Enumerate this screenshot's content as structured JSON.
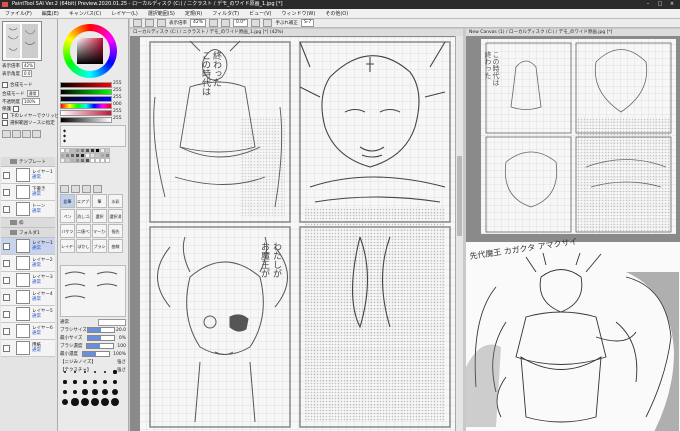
{
  "window": {
    "title": "PaintTool SAI Ver.2 (64bit) Preview.2020.01.25 - ローカルディスク (C:) / ニクラスト / デモ_のワイド原画_1.jpg [*]",
    "controls": [
      "–",
      "□",
      "×"
    ]
  },
  "menu": [
    "ファイル(F)",
    "編集(E)",
    "キャンバス(C)",
    "レイヤー(L)",
    "選択範囲(S)",
    "定規(R)",
    "フィルタ(T)",
    "ビュー(V)",
    "ウィンドウ(W)",
    "その他(O)"
  ],
  "toolbar": {
    "zoom_label": "表示倍率",
    "zoom_value": "42%",
    "angle_value": "0.0°",
    "stabilizer_label": "手ぶれ補正"
  },
  "navigator": {
    "zoom_label": "表示倍率",
    "zoom_value": "42%",
    "angle_label": "表示角度",
    "angle_value": "0.0"
  },
  "layer_panel": {
    "header": "合成モード",
    "blend_label": "合成モード",
    "blend_value": "通常",
    "opacity_label": "不透明度",
    "opacity_value": "100%",
    "protect_label": "保護",
    "clip_label": "下のレイヤーでクリッピング",
    "select_source_label": "選択範囲ソースに指定",
    "layers": [
      {
        "type": "folder",
        "name": "テンプレート"
      },
      {
        "type": "layer",
        "name": "レイヤー1",
        "blend": "通常"
      },
      {
        "type": "layer",
        "name": "下書き",
        "blend": "通常"
      },
      {
        "type": "layer",
        "name": "トーン",
        "blend": "通常"
      },
      {
        "type": "folder",
        "name": "枠"
      },
      {
        "type": "folder",
        "name": "フォルダ1"
      },
      {
        "type": "layer",
        "name": "レイヤー1",
        "blend": "通常",
        "selected": true
      },
      {
        "type": "layer",
        "name": "レイヤー2",
        "blend": "通常"
      },
      {
        "type": "layer",
        "name": "レイヤー3",
        "blend": "通常"
      },
      {
        "type": "layer",
        "name": "レイヤー4",
        "blend": "通常"
      },
      {
        "type": "layer",
        "name": "レイヤー5",
        "blend": "通常"
      },
      {
        "type": "layer",
        "name": "レイヤー6",
        "blend": "通常"
      },
      {
        "type": "layer",
        "name": "用紙",
        "blend": "通常"
      }
    ]
  },
  "color": {
    "current": "#c8133a",
    "sliders": [
      {
        "label": "R",
        "value": "255",
        "gradient": "#ff0000"
      },
      {
        "label": "G",
        "value": "255",
        "gradient": "#00ff00"
      },
      {
        "label": "B",
        "value": "255",
        "gradient": "#0000ff"
      },
      {
        "label": "H",
        "value": "000",
        "gradient": "hue"
      },
      {
        "label": "S",
        "value": "255",
        "gradient": "#c8133a"
      },
      {
        "label": "V",
        "value": "255",
        "gradient": "#000000"
      }
    ]
  },
  "tools": [
    "鉛筆",
    "エアブラシ",
    "筆",
    "水彩",
    "ペン",
    "消しゴム",
    "選択",
    "選択消",
    "バケツ",
    "二値ペン",
    "マーカー",
    "指先",
    "レイヤー",
    "ぼかし",
    "ブラシ",
    "曲線"
  ],
  "brush_props": [
    {
      "label": "通常",
      "value": ""
    },
    {
      "label": "ブラシサイズ",
      "value": "20.0"
    },
    {
      "label": "最小サイズ",
      "value": "0%"
    },
    {
      "label": "ブラシ濃度",
      "value": "100"
    },
    {
      "label": "最小濃度",
      "value": "100%"
    },
    {
      "label": "【ニジみノイズ】",
      "value": "強さ"
    },
    {
      "label": "【テクスチャ】",
      "value": "強さ"
    }
  ],
  "brush_dot_sizes": [
    0.7,
    0.8,
    1,
    1.5,
    2,
    2.3,
    2.6,
    3,
    3.5,
    4,
    5,
    6,
    7,
    8,
    9,
    10,
    12,
    14,
    16,
    20,
    25,
    30,
    35,
    40
  ],
  "canvases": [
    {
      "tab": "ローカルディスク (C:) / ニクラスト / デモ_のワイド原画_1.jpg [*] (42%)"
    },
    {
      "tab": "New Canvas (1) / ローカルディスク (C:) / デモ_のワイド原画.jpg [*]"
    }
  ],
  "art_text": {
    "vertical_1": "この時代は",
    "vertical_2": "終わった",
    "vertical_3": "わたしが",
    "vertical_4": "お魔王が",
    "sketch_note": "先代魔王 カガクタ アマクサイ"
  }
}
